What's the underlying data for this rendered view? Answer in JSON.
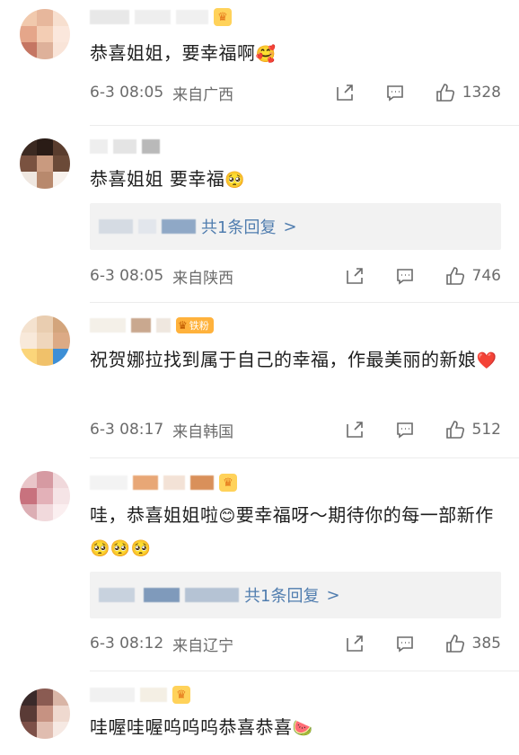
{
  "comments": [
    {
      "text": "恭喜姐姐，要幸福啊",
      "emoji": "🥰",
      "date": "6-3 08:05",
      "location": "来自广西",
      "likes": "1328",
      "reply": null
    },
    {
      "text": "恭喜姐姐  要幸福",
      "emoji": "🥺",
      "date": "6-3 08:05",
      "location": "来自陕西",
      "likes": "746",
      "reply": "共1条回复"
    },
    {
      "text": "祝贺娜拉找到属于自己的幸福，作最美丽的新娘",
      "emoji": "❤️",
      "badge": "铁粉",
      "date": "6-3 08:17",
      "location": "来自韩国",
      "likes": "512",
      "reply": null
    },
    {
      "text_a": "哇，恭喜姐姐啦",
      "emoji_a": "😊",
      "text_b": "要幸福呀～期待你的每一部新作",
      "emoji_b": "🥺🥺🥺",
      "date": "6-3 08:12",
      "location": "来自辽宁",
      "likes": "385",
      "reply": "共1条回复"
    },
    {
      "text": "哇喔哇喔呜呜呜恭喜恭喜",
      "emoji": "🍉"
    }
  ],
  "icons": {
    "share": "share-icon",
    "comment": "comment-icon",
    "like": "thumbs-up-icon",
    "crown": "crown-icon"
  },
  "colors": {
    "link": "#507daf",
    "meta": "#6b6b6b",
    "reply_bg": "#f2f2f2",
    "heart": "#e0343a"
  }
}
